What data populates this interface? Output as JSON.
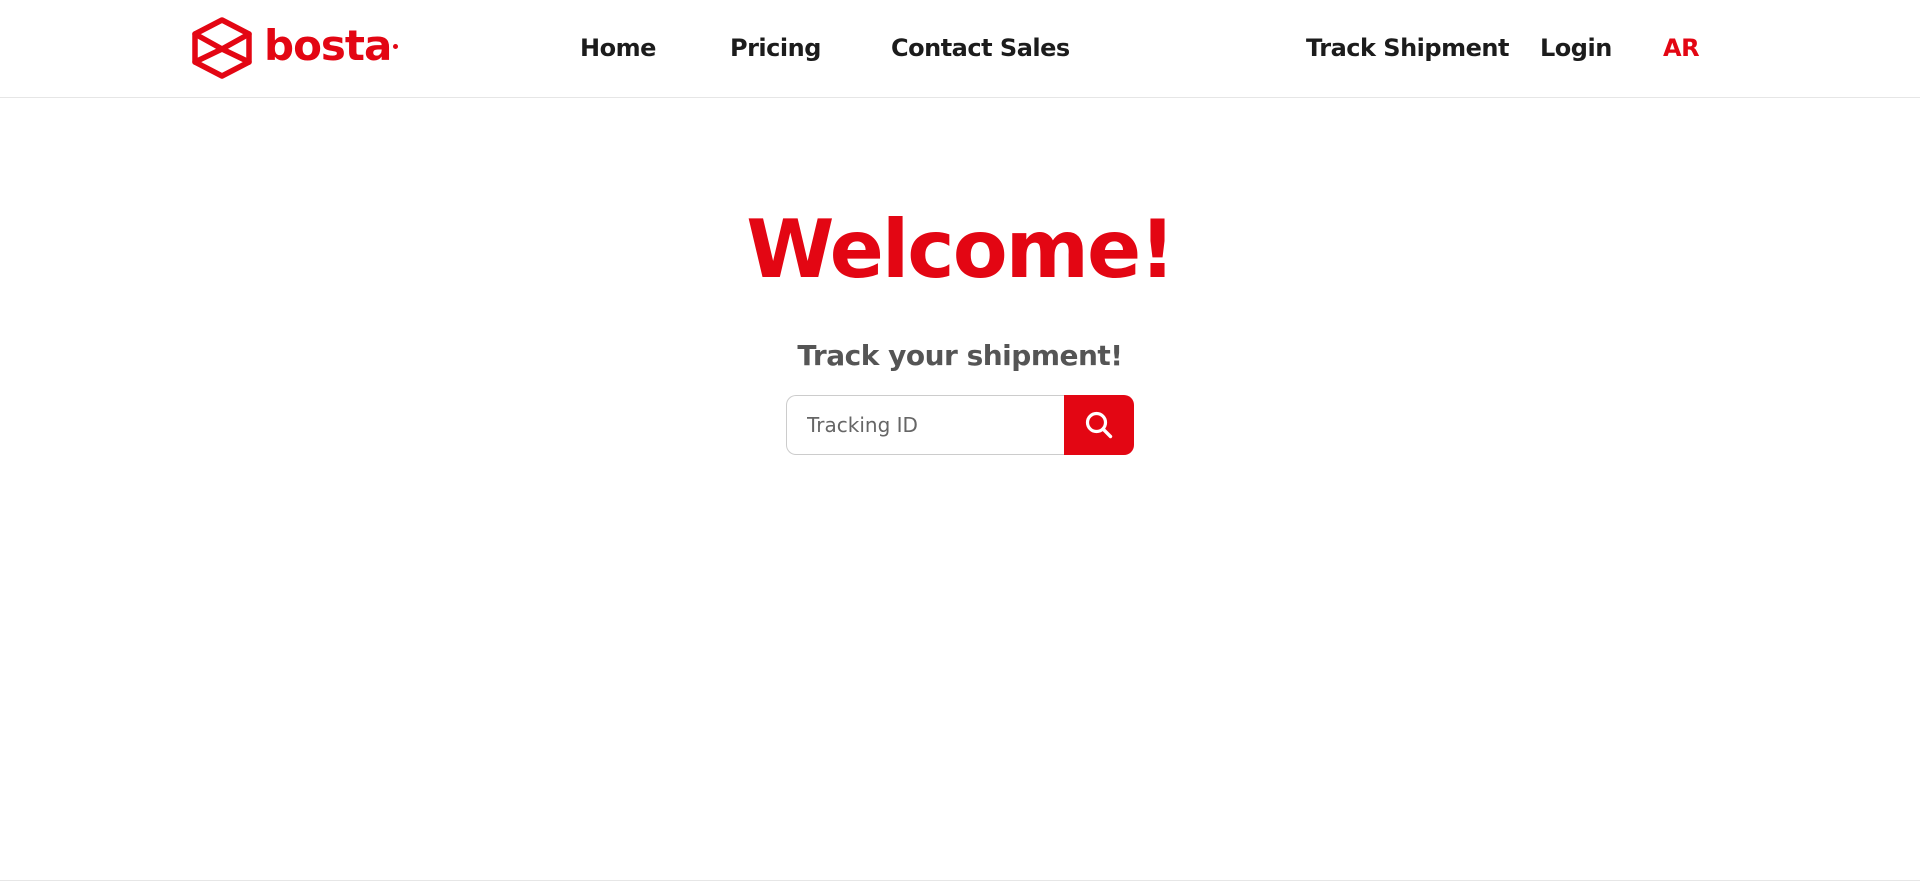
{
  "brand": {
    "name": "bosta",
    "accent_color": "#e30613"
  },
  "nav": {
    "home": "Home",
    "pricing": "Pricing",
    "contact_sales": "Contact Sales",
    "track_shipment": "Track Shipment",
    "login": "Login",
    "language": "AR"
  },
  "hero": {
    "title": "Welcome!",
    "subtitle": "Track your shipment!"
  },
  "search": {
    "placeholder": "Tracking ID",
    "button_icon": "search-icon"
  }
}
